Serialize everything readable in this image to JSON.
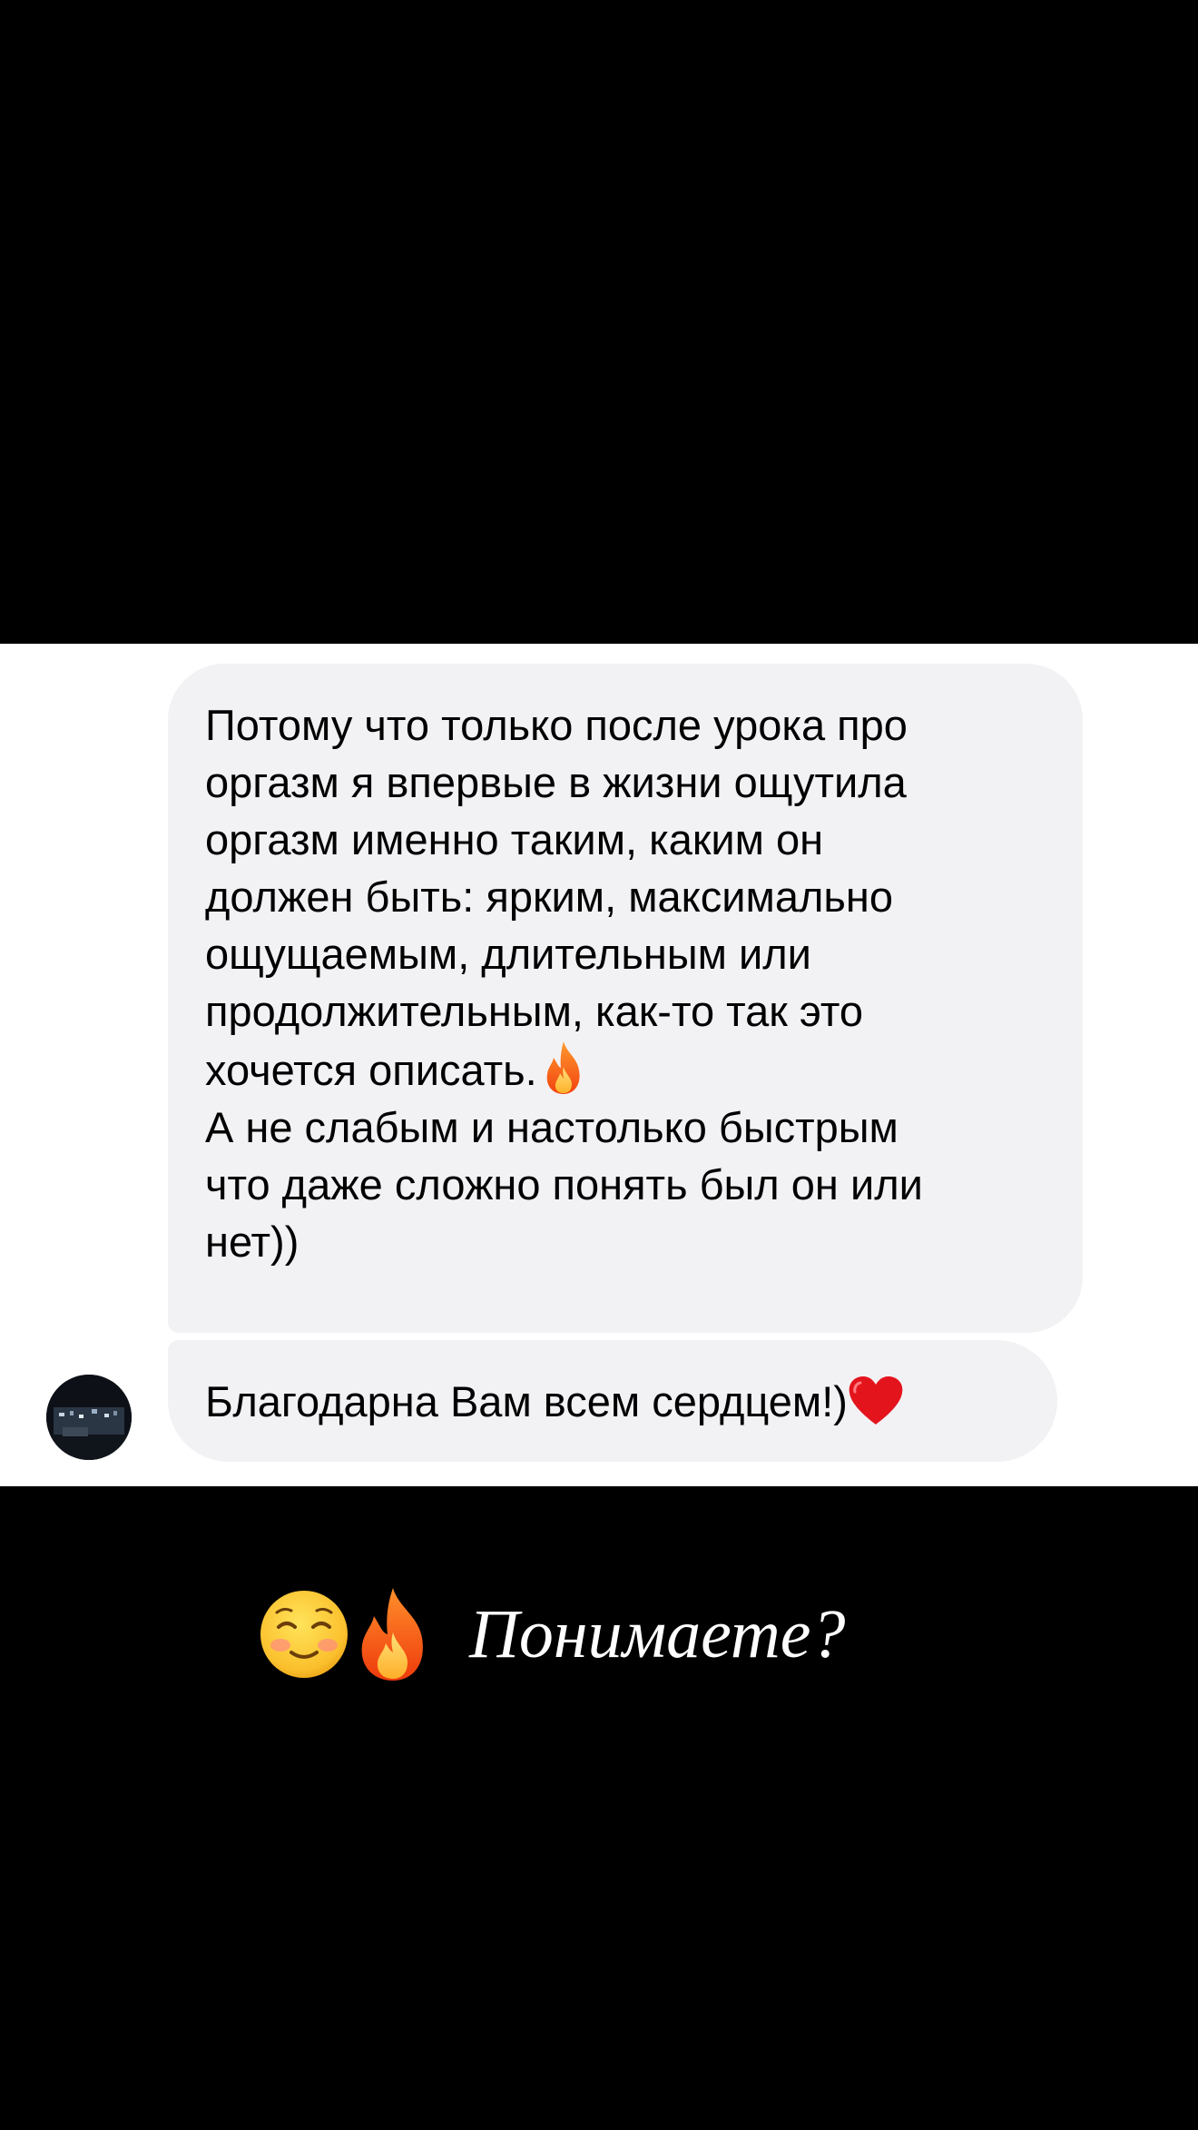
{
  "chat": {
    "message_1_lines": "Потому что только после урока про\nоргазм я впервые в жизни ощутила\nоргазм именно таким, каким он\nдолжен быть: ярким, максимально\nощущаемым, длительным или\nпродолжительным, как-то так это\nхочется описать.",
    "message_1_continuation": "А не слабым и настолько быстрым\nчто даже сложно понять был он или\nнет))",
    "message_1_emoji": "fire-emoji",
    "message_2_text": "Благодарна Вам всем сердцем!)",
    "message_2_emoji": "red-heart-emoji",
    "bubble_color": "#f2f2f5",
    "avatar_icon": "avatar-photo"
  },
  "caption": {
    "emoji_1": "smiling-face-emoji",
    "emoji_2": "fire-emoji",
    "text": "Понимаете?",
    "text_color": "#ffffff"
  }
}
